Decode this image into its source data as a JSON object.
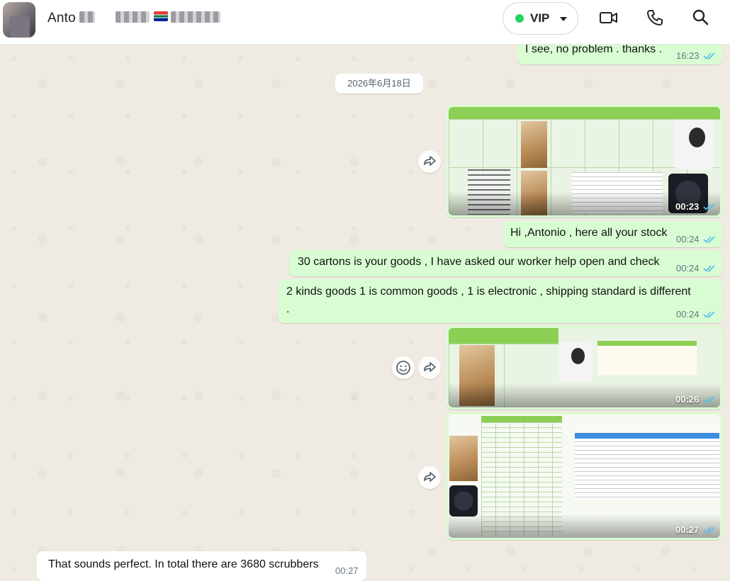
{
  "header": {
    "contact_name": "Anto",
    "vip": {
      "label": "VIP",
      "status_color": "#25d366"
    }
  },
  "chat": {
    "date_separator": "2026年6月18日",
    "messages": [
      {
        "text": "I see, no problem .  thanks  .",
        "time": "16:23"
      },
      {
        "media_time": "00:23"
      },
      {
        "text": "Hi ,Antonio , here all your stock",
        "time": "00:24"
      },
      {
        "text": "30 cartons is your goods , I have asked our worker help open and check",
        "time": "00:24"
      },
      {
        "text": "2 kinds goods 1 is common goods , 1 is electronic , shipping standard is different",
        "text2": ".",
        "time": "00:24"
      },
      {
        "media_time": "00:26"
      },
      {
        "media_time": "00:27"
      },
      {
        "text": "That sounds perfect. In total there are 3680 scrubbers",
        "time": "00:27"
      }
    ]
  },
  "colors": {
    "outgoing_bubble": "#d9fdd3",
    "incoming_bubble": "#ffffff",
    "read_ticks": "#53bdeb",
    "wallpaper": "#efeae2"
  },
  "icons": {
    "video_call": "video-camera-icon",
    "voice_call": "phone-icon",
    "search": "search-icon",
    "forward": "forward-icon",
    "emoji": "emoji-icon",
    "read_receipt": "double-check-icon"
  }
}
